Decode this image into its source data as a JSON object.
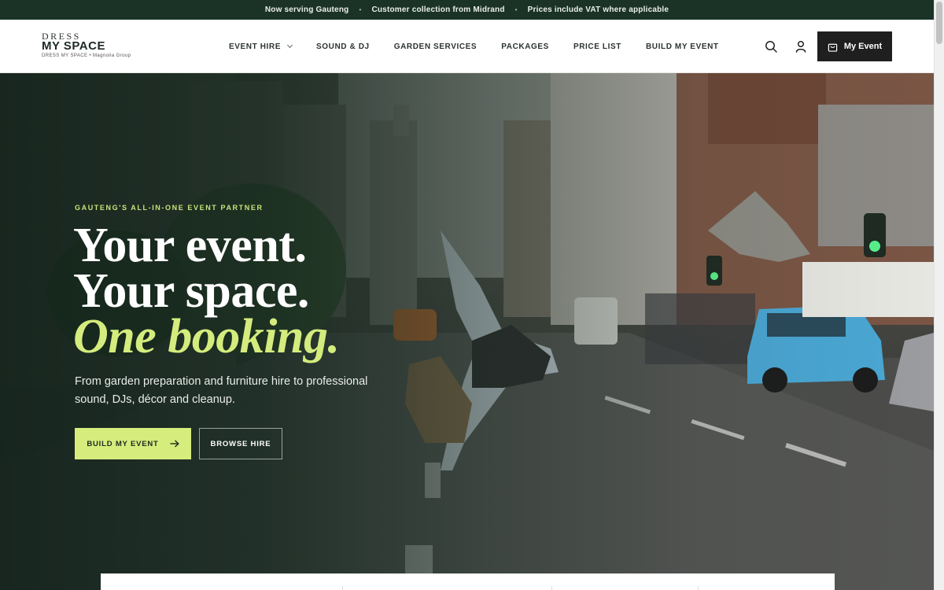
{
  "announcement": {
    "items": [
      "Now serving Gauteng",
      "Customer collection from Midrand",
      "Prices include VAT where applicable"
    ],
    "separator": "•"
  },
  "brand": {
    "line1": "DRESS",
    "line2": "MY SPACE",
    "tagline": "DRESS MY SPACE • Magnolia Group"
  },
  "nav": {
    "items": [
      {
        "label": "EVENT HIRE",
        "has_dropdown": true
      },
      {
        "label": "SOUND & DJ"
      },
      {
        "label": "GARDEN SERVICES"
      },
      {
        "label": "PACKAGES"
      },
      {
        "label": "PRICE LIST"
      },
      {
        "label": "BUILD MY EVENT"
      }
    ]
  },
  "header_actions": {
    "search_icon": "search-icon",
    "account_icon": "user-icon",
    "cart_label": "My Event",
    "cart_icon": "shopping-bag-icon"
  },
  "hero": {
    "eyebrow": "GAUTENG'S ALL-IN-ONE EVENT PARTNER",
    "headline_1": "Your event.",
    "headline_2": "Your space.",
    "headline_3": "One booking.",
    "subtext": "From garden preparation and furniture hire to professional sound, DJs, décor and cleanup.",
    "primary_cta": "BUILD MY EVENT",
    "secondary_cta": "BROWSE HIRE",
    "background_description_icon": "street-photo"
  },
  "colors": {
    "announce_bg": "#1b3326",
    "accent_lime": "#d6ec7c",
    "hero_overlay": "#12221a",
    "cart_bg": "#1e1f1e"
  }
}
